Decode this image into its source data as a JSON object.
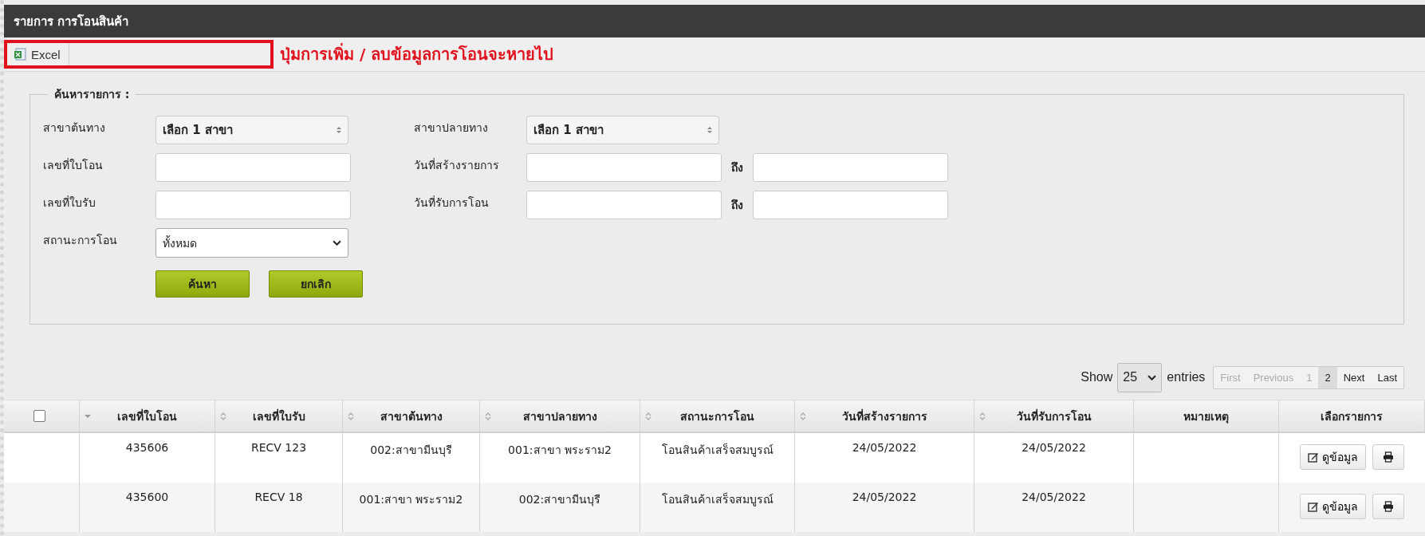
{
  "window": {
    "title": "รายการ การโอนสินค้า"
  },
  "toolbar": {
    "buttons": [
      {
        "label": "Excel"
      }
    ],
    "annotation": "ปุ่มการเพิ่ม / ลบข้อมูลการโอนจะหายไป"
  },
  "search": {
    "legend": "ค้นหารายการ :",
    "fields": [
      {
        "label": "สาขาต้นทาง",
        "kind": "branch",
        "value": "เลือก 1 สาขา"
      },
      {
        "label": "สาขาปลายทาง",
        "kind": "branch",
        "value": "เลือก 1 สาขา"
      },
      {
        "label": "เลขที่ใบโอน",
        "kind": "text"
      },
      {
        "label": "วันที่สร้างรายการ",
        "kind": "range",
        "to_label": "ถึง"
      },
      {
        "label": "เลขที่ใบรับ",
        "kind": "text"
      },
      {
        "label": "วันที่รับการโอน",
        "kind": "range",
        "to_label": "ถึง"
      },
      {
        "label": "สถานะการโอน",
        "kind": "select",
        "value": "ทั้งหมด"
      }
    ],
    "buttons": [
      "ค้นหา",
      "ยกเลิก"
    ]
  },
  "length": {
    "prefix": "Show",
    "value": "25",
    "suffix": "entries"
  },
  "pagination": [
    {
      "label": "First",
      "disabled": true,
      "selected": false
    },
    {
      "label": "Previous",
      "disabled": true,
      "selected": false
    },
    {
      "label": "1",
      "disabled": true,
      "selected": false
    },
    {
      "label": "2",
      "disabled": false,
      "selected": true
    },
    {
      "label": "Next",
      "disabled": false,
      "selected": false
    },
    {
      "label": "Last",
      "disabled": false,
      "selected": false
    }
  ],
  "table": {
    "select_all": {
      "checked": false
    },
    "columns": [
      {
        "label": "เลขที่ใบโอน",
        "sortable": true,
        "sorted": true
      },
      {
        "label": "เลขที่ใบรับ",
        "sortable": true,
        "sorted": false
      },
      {
        "label": "สาขาต้นทาง",
        "sortable": true,
        "sorted": false
      },
      {
        "label": "สาขาปลายทาง",
        "sortable": true,
        "sorted": false
      },
      {
        "label": "สถานะการโอน",
        "sortable": true,
        "sorted": false
      },
      {
        "label": "วันที่สร้างรายการ",
        "sortable": true,
        "sorted": false
      },
      {
        "label": "วันที่รับการโอน",
        "sortable": true,
        "sorted": false
      },
      {
        "label": "หมายเหตุ",
        "sortable": false,
        "sorted": false
      },
      {
        "label": "เลือกรายการ",
        "sortable": false,
        "sorted": false
      }
    ],
    "rows": [
      {
        "cells": [
          "435606",
          "RECV 123",
          "002:สาขามีนบุรี",
          "001:สาขา พระราม2",
          "โอนสินค้าเสร็จสมบูรณ์",
          "24/05/2022",
          "24/05/2022"
        ],
        "view_label": "ดูข้อมูล"
      },
      {
        "cells": [
          "435600",
          "RECV 18",
          "001:สาขา พระราม2",
          "002:สาขามีนบุรี",
          "โอนสินค้าเสร็จสมบูรณ์",
          "24/05/2022",
          "24/05/2022"
        ],
        "view_label": "ดูข้อมูล"
      }
    ]
  }
}
